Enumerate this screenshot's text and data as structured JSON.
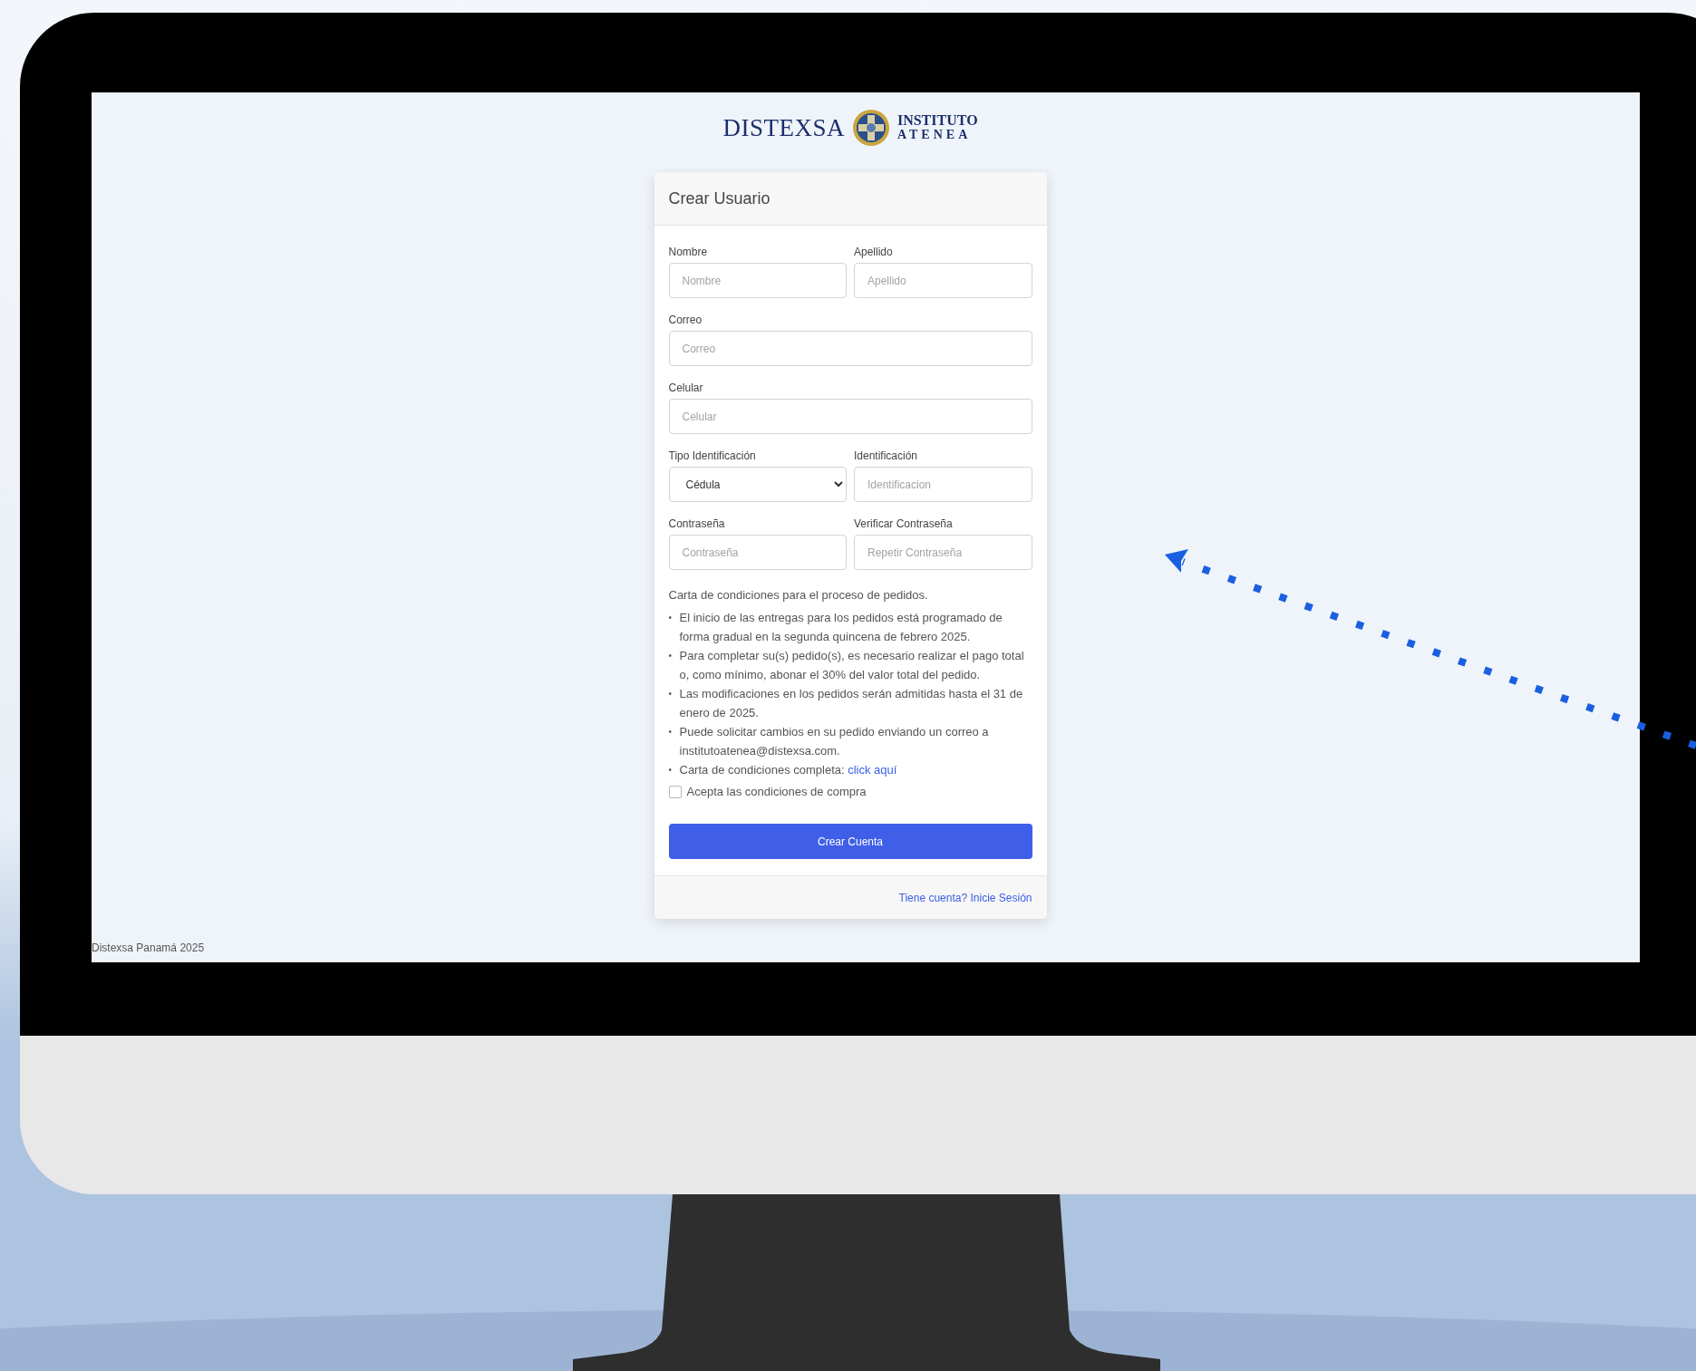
{
  "logo": {
    "left": "DISTEXSA",
    "right_top": "INSTITUTO",
    "right_bottom": "ATENEA"
  },
  "form": {
    "title": "Crear Usuario",
    "rows": [
      [
        {
          "kind": "text",
          "label": "Nombre",
          "placeholder": "Nombre"
        },
        {
          "kind": "text",
          "label": "Apellido",
          "placeholder": "Apellido"
        }
      ],
      [
        {
          "kind": "text",
          "label": "Correo",
          "placeholder": "Correo"
        }
      ],
      [
        {
          "kind": "text",
          "label": "Celular",
          "placeholder": "Celular"
        }
      ],
      [
        {
          "kind": "select",
          "label": "Tipo Identificación",
          "value": "Cédula"
        },
        {
          "kind": "text",
          "label": "Identificación",
          "placeholder": "Identificacion"
        }
      ],
      [
        {
          "kind": "password",
          "label": "Contraseña",
          "placeholder": "Contraseña"
        },
        {
          "kind": "password",
          "label": "Verificar Contraseña",
          "placeholder": "Repetir Contraseña"
        }
      ]
    ],
    "conditions": {
      "intro": "Carta de condiciones para el proceso de pedidos.",
      "items": [
        {
          "marker": "•",
          "text": "El inicio de las entregas para los pedidos está programado de forma gradual en la segunda quincena de febrero 2025."
        },
        {
          "marker": "•",
          "text": "Para completar su(s) pedido(s), es necesario realizar el pago total o, como mínimo, abonar el 30% del valor total del pedido."
        },
        {
          "marker": "•",
          "text": "Las modificaciones en los pedidos serán admitidas hasta el 31 de enero de 2025."
        },
        {
          "marker": "•",
          "text": "Puede solicitar cambios en su pedido enviando un correo a institutoatenea@distexsa.com."
        },
        {
          "marker": "•",
          "text": "Carta de condiciones completa: ",
          "link": "click aquí"
        }
      ]
    },
    "checkbox": {
      "label": "Acepta las condiciones de compra",
      "checked": false
    },
    "button": "Crear Cuenta",
    "footer_link": "Tiene cuenta? Inicie Sesión"
  },
  "page_footer": "Distexsa Panamá 2025"
}
